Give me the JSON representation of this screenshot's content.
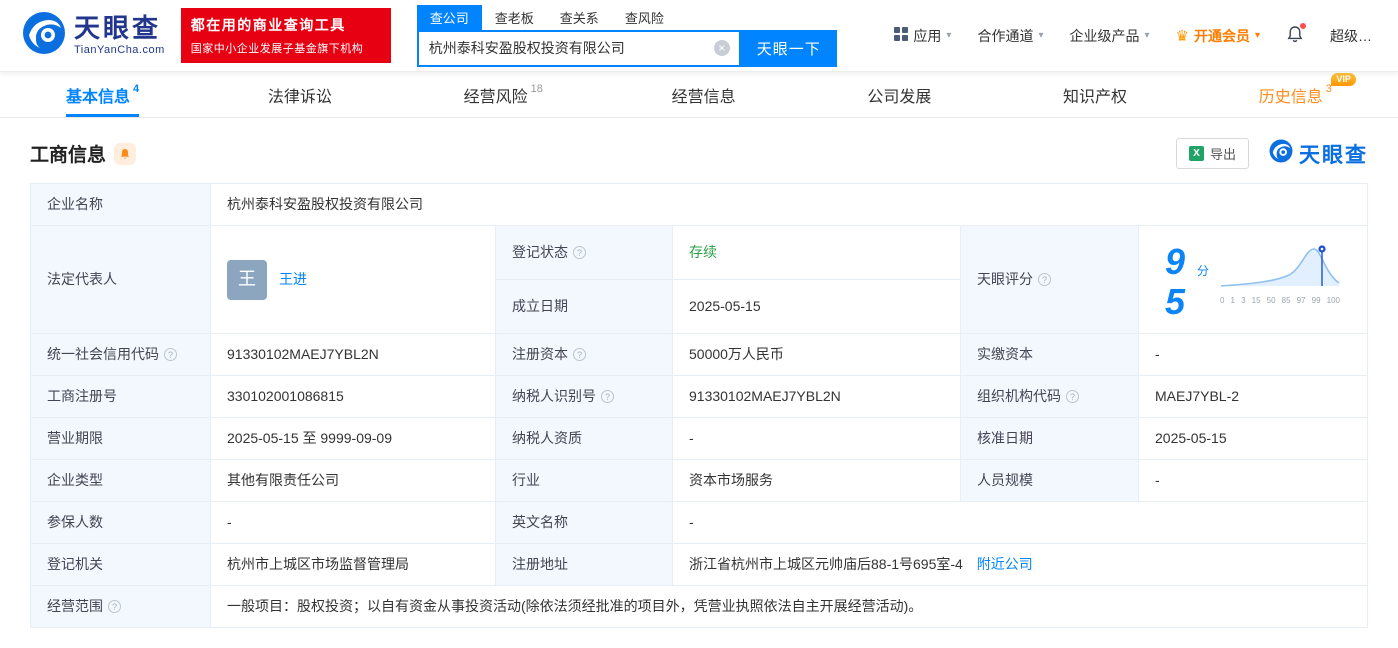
{
  "header": {
    "logo": {
      "brand": "天眼查",
      "domain": "TianYanCha.com"
    },
    "promo": {
      "line1": "都在用的商业查询工具",
      "line2": "国家中小企业发展子基金旗下机构"
    },
    "search": {
      "tabs": [
        {
          "label": "查公司"
        },
        {
          "label": "查老板"
        },
        {
          "label": "查关系"
        },
        {
          "label": "查风险"
        }
      ],
      "value": "杭州泰科安盈股权投资有限公司",
      "button": "天眼一下"
    },
    "nav": {
      "apps": "应用",
      "cooperation": "合作通道",
      "enterprise": "企业级产品",
      "vip": "开通会员",
      "super": "超级…"
    }
  },
  "tabs": [
    {
      "label": "基本信息",
      "count": "4"
    },
    {
      "label": "法律诉讼",
      "count": ""
    },
    {
      "label": "经营风险",
      "count": "18"
    },
    {
      "label": "经营信息",
      "count": ""
    },
    {
      "label": "公司发展",
      "count": ""
    },
    {
      "label": "知识产权",
      "count": ""
    },
    {
      "label": "历史信息",
      "count": "3",
      "badge": "VIP"
    }
  ],
  "section": {
    "title": "工商信息",
    "export_label": "导出",
    "watermark": "天眼查"
  },
  "fields": {
    "company_name": {
      "label": "企业名称",
      "value": "杭州泰科安盈股权投资有限公司"
    },
    "legal_rep": {
      "label": "法定代表人",
      "value": "王进",
      "avatar": "王"
    },
    "reg_status": {
      "label": "登记状态",
      "value": "存续"
    },
    "establish_date": {
      "label": "成立日期",
      "value": "2025-05-15"
    },
    "score_label": "天眼评分",
    "credit_code": {
      "label": "统一社会信用代码",
      "value": "91330102MAEJ7YBL2N"
    },
    "reg_capital": {
      "label": "注册资本",
      "value": "50000万人民币"
    },
    "paid_capital": {
      "label": "实缴资本",
      "value": "-"
    },
    "reg_number": {
      "label": "工商注册号",
      "value": "330102001086815"
    },
    "taxpayer_id": {
      "label": "纳税人识别号",
      "value": "91330102MAEJ7YBL2N"
    },
    "org_code": {
      "label": "组织机构代码",
      "value": "MAEJ7YBL-2"
    },
    "business_term": {
      "label": "营业期限",
      "value": "2025-05-15 至 9999-09-09"
    },
    "taxpayer_quality": {
      "label": "纳税人资质",
      "value": "-"
    },
    "approval_date": {
      "label": "核准日期",
      "value": "2025-05-15"
    },
    "company_type": {
      "label": "企业类型",
      "value": "其他有限责任公司"
    },
    "industry": {
      "label": "行业",
      "value": "资本市场服务"
    },
    "staff_size": {
      "label": "人员规模",
      "value": "-"
    },
    "insured_count": {
      "label": "参保人数",
      "value": "-"
    },
    "english_name": {
      "label": "英文名称",
      "value": "-"
    },
    "reg_authority": {
      "label": "登记机关",
      "value": "杭州市上城区市场监督管理局"
    },
    "reg_address": {
      "label": "注册地址",
      "value": "浙江省杭州市上城区元帅庙后88-1号695室-4",
      "link": "附近公司"
    },
    "business_scope": {
      "label": "经营范围",
      "value": "一般项目：股权投资；以自有资金从事投资活动(除依法须经批准的项目外，凭营业执照依法自主开展经营活动)。"
    }
  },
  "score": {
    "value": "95",
    "unit": "分",
    "axis": [
      "0",
      "1",
      "3",
      "15",
      "50",
      "85",
      "97",
      "99",
      "100"
    ]
  },
  "icons": {
    "help": "?",
    "caret": "▾",
    "clear": "×",
    "crown": "♛",
    "excel": "X"
  },
  "colors": {
    "accent": "#0084ff",
    "promo_red": "#e60012",
    "status_green": "#2ba245",
    "vip_orange": "#ff8c1a"
  }
}
